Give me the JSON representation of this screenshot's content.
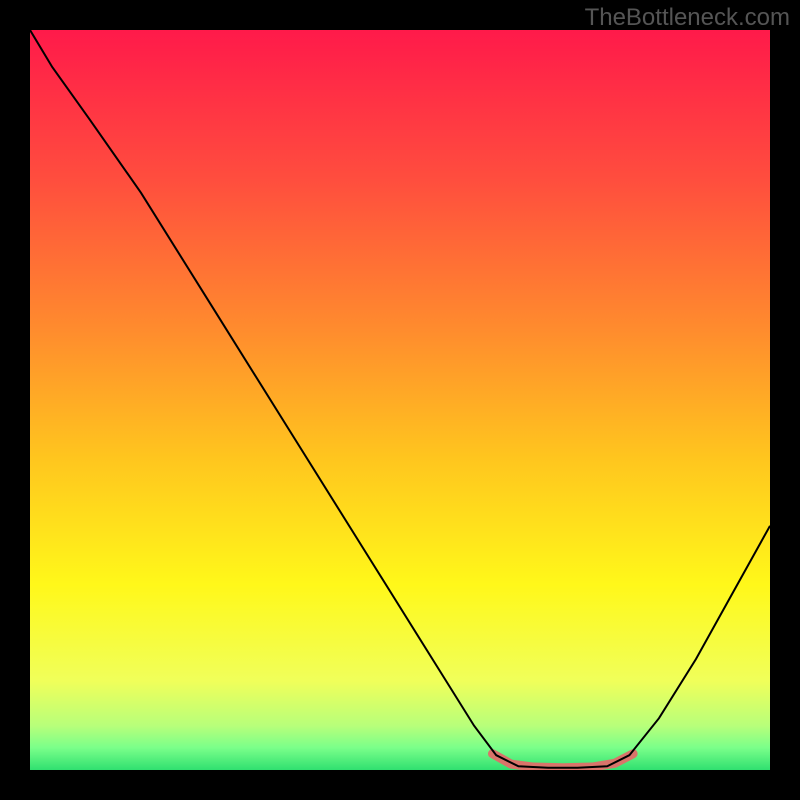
{
  "watermark": "TheBottleneck.com",
  "chart_data": {
    "type": "line",
    "title": "",
    "xlabel": "",
    "ylabel": "",
    "xlim": [
      0,
      100
    ],
    "ylim": [
      0,
      100
    ],
    "background_gradient": {
      "stops": [
        {
          "offset": 0.0,
          "color": "#ff1a4a"
        },
        {
          "offset": 0.2,
          "color": "#ff4d3e"
        },
        {
          "offset": 0.4,
          "color": "#ff8a2e"
        },
        {
          "offset": 0.58,
          "color": "#ffc61e"
        },
        {
          "offset": 0.75,
          "color": "#fff81a"
        },
        {
          "offset": 0.88,
          "color": "#f0ff5a"
        },
        {
          "offset": 0.94,
          "color": "#b8ff7a"
        },
        {
          "offset": 0.97,
          "color": "#7aff8a"
        },
        {
          "offset": 1.0,
          "color": "#30e070"
        }
      ]
    },
    "series": [
      {
        "name": "bottleneck-curve",
        "color": "#000000",
        "width": 2,
        "points": [
          {
            "x": 0,
            "y": 100
          },
          {
            "x": 3,
            "y": 95
          },
          {
            "x": 8,
            "y": 88
          },
          {
            "x": 15,
            "y": 78
          },
          {
            "x": 25,
            "y": 62
          },
          {
            "x": 35,
            "y": 46
          },
          {
            "x": 45,
            "y": 30
          },
          {
            "x": 55,
            "y": 14
          },
          {
            "x": 60,
            "y": 6
          },
          {
            "x": 63,
            "y": 2
          },
          {
            "x": 66,
            "y": 0.5
          },
          {
            "x": 70,
            "y": 0.3
          },
          {
            "x": 74,
            "y": 0.3
          },
          {
            "x": 78,
            "y": 0.5
          },
          {
            "x": 81,
            "y": 2
          },
          {
            "x": 85,
            "y": 7
          },
          {
            "x": 90,
            "y": 15
          },
          {
            "x": 95,
            "y": 24
          },
          {
            "x": 100,
            "y": 33
          }
        ]
      },
      {
        "name": "highlight-segment",
        "color": "#d9746a",
        "width": 9,
        "linecap": "round",
        "points": [
          {
            "x": 62.5,
            "y": 2.2
          },
          {
            "x": 65,
            "y": 0.8
          },
          {
            "x": 68,
            "y": 0.4
          },
          {
            "x": 72,
            "y": 0.3
          },
          {
            "x": 76,
            "y": 0.4
          },
          {
            "x": 79,
            "y": 0.9
          },
          {
            "x": 81.5,
            "y": 2.2
          }
        ]
      }
    ]
  }
}
